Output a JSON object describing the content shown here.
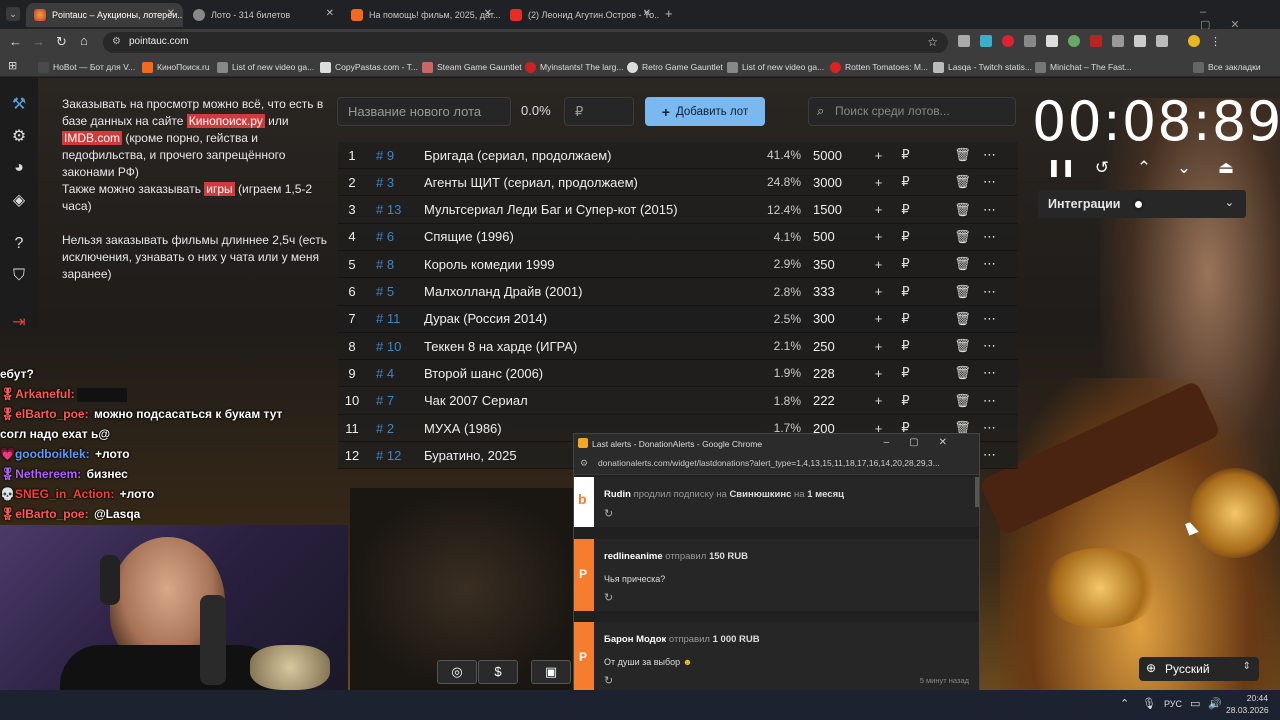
{
  "browser": {
    "tabs": [
      {
        "title": "Pointauc – Аукционы, лотереи..."
      },
      {
        "title": "Лото - 314 билетов"
      },
      {
        "title": "На помощь! фильм, 2025, дат..."
      },
      {
        "title": "(2) Леонид Агутин.Остров - Yo..."
      }
    ],
    "url": "pointauc.com",
    "bookmarks": [
      "НоBot — Бот для V...",
      "КиноПоиск.ru",
      "List of new video ga...",
      "CopyPastas.com - T...",
      "Steam Game Gauntlet",
      "Myinstants! The larg...",
      "Retro Game Gauntlet",
      "List of new video ga...",
      "Rotten Tomatoes: M...",
      "Lasqa - Twitch statis...",
      "Minichat – The Fast...",
      "Все закладки"
    ]
  },
  "rules": {
    "p1_a": "Заказывать на просмотр можно всё, что есть в базе данных на сайте ",
    "p1_link1": "Кинопоиск.ру",
    "p1_b": " или ",
    "p1_link2": "IMDB.com",
    "p1_c": " (кроме порно, гейства и педофильства, и прочего запрещённого законами РФ)",
    "p2_a": "Также можно заказывать ",
    "p2_link": "игры",
    "p2_b": " (играем 1,5-2 часа)",
    "p3": "Нельзя заказывать фильмы длиннее 2,5ч (есть исключения, узнавать о них у чата или у меня заранее)"
  },
  "lot_form": {
    "name_placeholder": "Название нового лота",
    "percent": "0.0%",
    "currency": "₽",
    "add_label": "Добавить лот",
    "search_placeholder": "Поиск среди лотов..."
  },
  "lots": [
    {
      "n": "1",
      "id": "# 9",
      "name": "Бригада (сериал, продолжаем)",
      "pct": "41.4%",
      "amount": "5000"
    },
    {
      "n": "2",
      "id": "# 3",
      "name": "Агенты ЩИТ (сериал, продолжаем)",
      "pct": "24.8%",
      "amount": "3000"
    },
    {
      "n": "3",
      "id": "# 13",
      "name": "Мультсериал Леди Баг и Супер-кот (2015)",
      "pct": "12.4%",
      "amount": "1500"
    },
    {
      "n": "4",
      "id": "# 6",
      "name": "Спящие (1996)",
      "pct": "4.1%",
      "amount": "500"
    },
    {
      "n": "5",
      "id": "# 8",
      "name": "Король комедии 1999",
      "pct": "2.9%",
      "amount": "350"
    },
    {
      "n": "6",
      "id": "# 5",
      "name": "Малхолланд Драйв (2001)",
      "pct": "2.8%",
      "amount": "333"
    },
    {
      "n": "7",
      "id": "# 11",
      "name": "Дурак (Россия 2014)",
      "pct": "2.5%",
      "amount": "300"
    },
    {
      "n": "8",
      "id": "# 10",
      "name": "Теккен 8 на харде (ИГРА)",
      "pct": "2.1%",
      "amount": "250"
    },
    {
      "n": "9",
      "id": "# 4",
      "name": "Второй шанс (2006)",
      "pct": "1.9%",
      "amount": "228"
    },
    {
      "n": "10",
      "id": "# 7",
      "name": "Чак 2007 Сериал",
      "pct": "1.8%",
      "amount": "222"
    },
    {
      "n": "11",
      "id": "# 2",
      "name": "МУХА (1986)",
      "pct": "1.7%",
      "amount": "200"
    },
    {
      "n": "12",
      "id": "# 12",
      "name": "Буратино, 2025",
      "pct": "",
      "amount": ""
    }
  ],
  "timer": {
    "value": "00:08:89"
  },
  "integrations_label": "Интеграции",
  "language_label": "Русский",
  "chat": [
    {
      "user": "",
      "text": "ебут?"
    },
    {
      "user": "Arkaneful",
      "text": ""
    },
    {
      "user": "elBarto_poe",
      "text": "можно подсасаться к букам тут согл надо ехат ь@"
    },
    {
      "user": "goodboiklek",
      "text": "+лото"
    },
    {
      "user": "Nethereem",
      "text": "бизнес"
    },
    {
      "user": "SNEG_in_Action",
      "text": "+лото"
    },
    {
      "user": "elBarto_poe",
      "text": "@Lasqa"
    }
  ],
  "popup": {
    "title": "Last alerts - DonationAlerts - Google Chrome",
    "url": "donationalerts.com/widget/lastdonations?alert_type=1,4,13,15,11,18,17,16,14,20,28,29,3...",
    "items": [
      {
        "user": "Rudin",
        "action": "продлил подписку на",
        "target": "Свинюшкинс",
        "on": "на",
        "period": "1 месяц",
        "message": ""
      },
      {
        "user": "redlineanime",
        "action": "отправил",
        "target": "150 RUB",
        "on": "",
        "period": "",
        "message": "Чья прическа?"
      },
      {
        "user": "Барон Модок",
        "action": "отправил",
        "target": "1 000 RUB",
        "on": "",
        "period": "",
        "message": "От души за выбор",
        "time": "5 минут назад"
      }
    ]
  },
  "taskbar": {
    "lang": "РУС",
    "time": "20:44",
    "date": "28.03.2026"
  },
  "colors": {
    "accent": "#79b9f0",
    "id_blue": "#3b86c8",
    "highlight_red": "#d23b3b",
    "donation_orange": "#f57d2d"
  }
}
